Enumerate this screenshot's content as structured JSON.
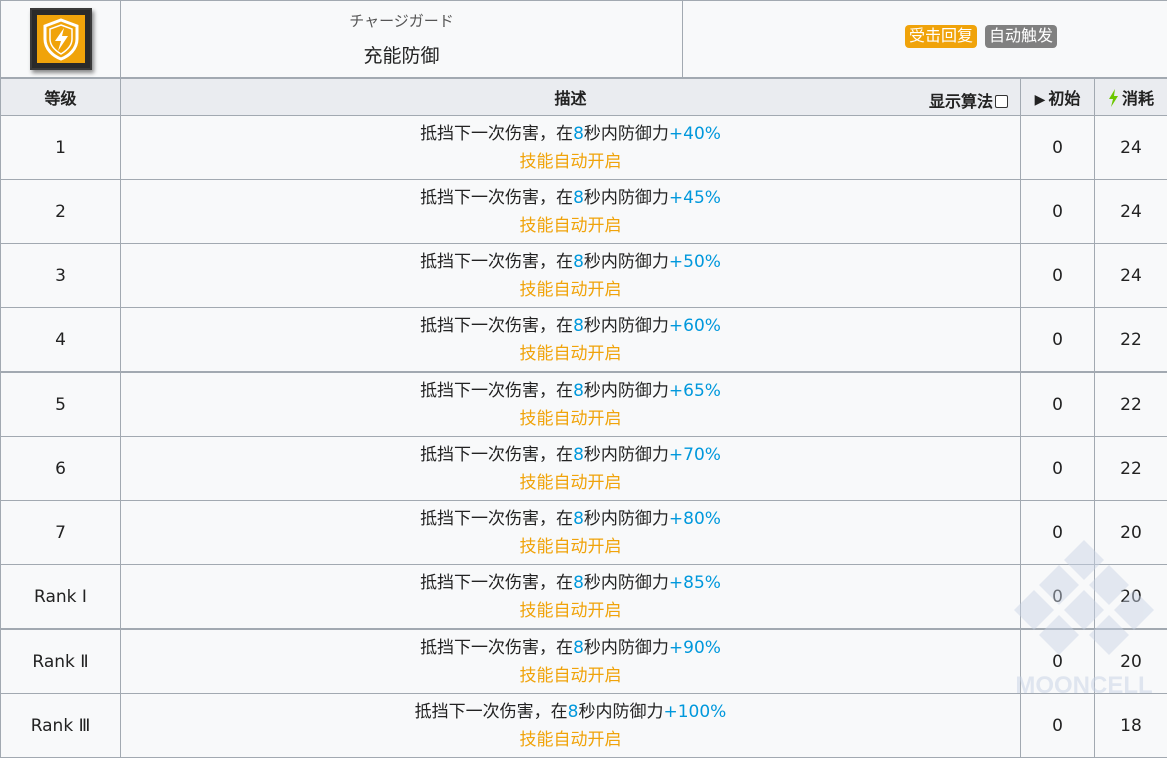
{
  "skill": {
    "icon": "shield-lightning-icon",
    "jp_name": "チャージガード",
    "cn_name": "充能防御",
    "tags": [
      {
        "label": "受击回复",
        "color": "#f0a30a"
      },
      {
        "label": "自动触发",
        "color": "#808080"
      }
    ]
  },
  "columns": {
    "level": "等级",
    "description": "描述",
    "show_algorithm": "显示算法",
    "initial": "初始",
    "cost": "消耗"
  },
  "rows": [
    {
      "level": "1",
      "desc_a": "抵挡下一次伤害，在",
      "duration": "8",
      "desc_b": "秒内防御力",
      "bonus": "+40%",
      "note": "技能自动开启",
      "initial": "0",
      "cost": "24"
    },
    {
      "level": "2",
      "desc_a": "抵挡下一次伤害，在",
      "duration": "8",
      "desc_b": "秒内防御力",
      "bonus": "+45%",
      "note": "技能自动开启",
      "initial": "0",
      "cost": "24"
    },
    {
      "level": "3",
      "desc_a": "抵挡下一次伤害，在",
      "duration": "8",
      "desc_b": "秒内防御力",
      "bonus": "+50%",
      "note": "技能自动开启",
      "initial": "0",
      "cost": "24"
    },
    {
      "level": "4",
      "desc_a": "抵挡下一次伤害，在",
      "duration": "8",
      "desc_b": "秒内防御力",
      "bonus": "+60%",
      "note": "技能自动开启",
      "initial": "0",
      "cost": "22"
    },
    {
      "level": "5",
      "desc_a": "抵挡下一次伤害，在",
      "duration": "8",
      "desc_b": "秒内防御力",
      "bonus": "+65%",
      "note": "技能自动开启",
      "initial": "0",
      "cost": "22"
    },
    {
      "level": "6",
      "desc_a": "抵挡下一次伤害，在",
      "duration": "8",
      "desc_b": "秒内防御力",
      "bonus": "+70%",
      "note": "技能自动开启",
      "initial": "0",
      "cost": "22"
    },
    {
      "level": "7",
      "desc_a": "抵挡下一次伤害，在",
      "duration": "8",
      "desc_b": "秒内防御力",
      "bonus": "+80%",
      "note": "技能自动开启",
      "initial": "0",
      "cost": "20"
    },
    {
      "level": "Rank Ⅰ",
      "desc_a": "抵挡下一次伤害，在",
      "duration": "8",
      "desc_b": "秒内防御力",
      "bonus": "+85%",
      "note": "技能自动开启",
      "initial": "0",
      "cost": "20"
    },
    {
      "level": "Rank Ⅱ",
      "desc_a": "抵挡下一次伤害，在",
      "duration": "8",
      "desc_b": "秒内防御力",
      "bonus": "+90%",
      "note": "技能自动开启",
      "initial": "0",
      "cost": "20"
    },
    {
      "level": "Rank Ⅲ",
      "desc_a": "抵挡下一次伤害，在",
      "duration": "8",
      "desc_b": "秒内防御力",
      "bonus": "+100%",
      "note": "技能自动开启",
      "initial": "0",
      "cost": "18"
    }
  ],
  "watermark": "MOONCELL",
  "colors": {
    "accent_blue": "#0098dc",
    "accent_orange": "#f0a30a",
    "cost_green": "#6bc700"
  }
}
